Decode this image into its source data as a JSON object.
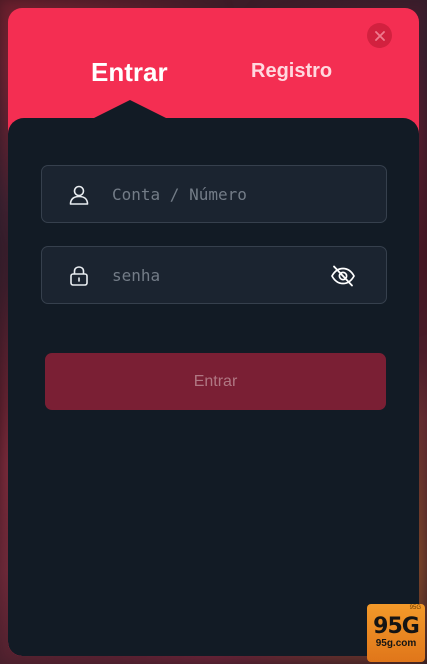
{
  "tabs": {
    "login_label": "Entrar",
    "register_label": "Registro"
  },
  "form": {
    "account_placeholder": "Conta / Número",
    "password_placeholder": "senha",
    "submit_label": "Entrar"
  },
  "icons": {
    "close": "close-icon",
    "user": "user-icon",
    "lock": "lock-icon",
    "eye": "eye-off-icon"
  },
  "badge": {
    "big_text": "95G",
    "small_text": "95g.com",
    "top_text": "95G"
  },
  "colors": {
    "accent": "#f42e52",
    "panel": "#121b25",
    "input_bg": "#1b2430",
    "submit_disabled": "#7a1f34"
  }
}
